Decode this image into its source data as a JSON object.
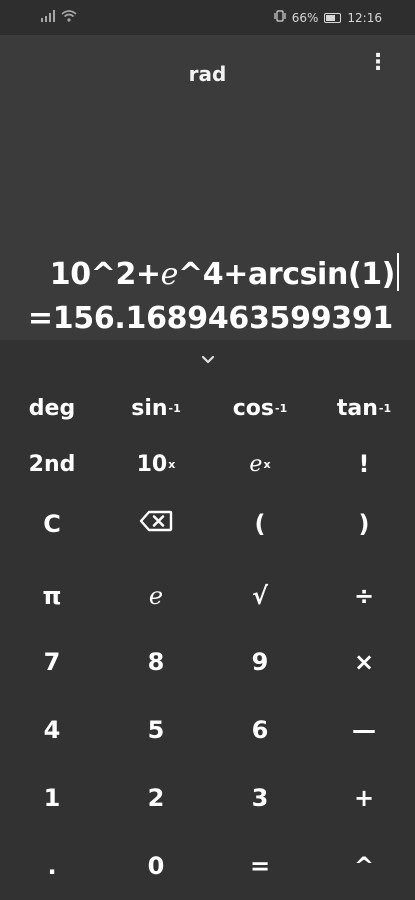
{
  "status_bar": {
    "battery_percent": "66%",
    "time": "12:16"
  },
  "display": {
    "mode": "rad",
    "expression_before_e": "10^2+",
    "expression_e": "e",
    "expression_after_e": "^4+arcsin(1)",
    "result": "=156.1689463599391"
  },
  "keypad": {
    "row1": {
      "deg": "deg",
      "sin": "sin",
      "cos": "cos",
      "tan": "tan",
      "inverse_sup": "-1"
    },
    "row2": {
      "second": "2nd",
      "ten_base": "10",
      "x_sup": "x",
      "e_base": "e",
      "factorial": "!"
    },
    "row3": {
      "clear": "C",
      "open_paren": "(",
      "close_paren": ")"
    },
    "row4": {
      "pi": "π",
      "e": "e",
      "sqrt": "√",
      "divide": "÷"
    },
    "row5": {
      "seven": "7",
      "eight": "8",
      "nine": "9",
      "multiply": "×"
    },
    "row6": {
      "four": "4",
      "five": "5",
      "six": "6",
      "minus": "—"
    },
    "row7": {
      "one": "1",
      "two": "2",
      "three": "3",
      "plus": "+"
    },
    "row8": {
      "decimal": ".",
      "zero": "0",
      "equals": "=",
      "power": "^"
    }
  },
  "icons": {
    "signal": "signal-icon",
    "wifi": "wifi-icon",
    "vibrate": "vibrate-icon",
    "battery": "battery-icon",
    "menu": "more-vert-icon",
    "collapse": "chevron-down-icon",
    "backspace": "backspace-icon"
  },
  "colors": {
    "background": "#323232",
    "display_background": "#3b3b3b",
    "text": "#ffffff"
  }
}
